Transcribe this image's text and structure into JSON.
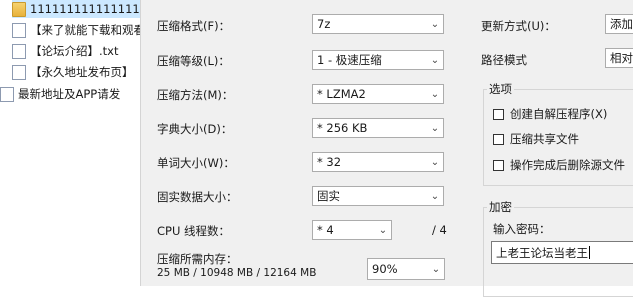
{
  "files": [
    {
      "name": "1111111111111111",
      "type": "folder",
      "selected": true
    },
    {
      "name": "【来了就能下载和观看",
      "type": "doc"
    },
    {
      "name": "【论坛介绍】.txt",
      "type": "doc"
    },
    {
      "name": "【永久地址发布页】",
      "type": "doc"
    },
    {
      "name": "最新地址及APP请发",
      "type": "doc"
    }
  ],
  "form": {
    "format_label": "压缩格式(F)：",
    "format_value": "7z",
    "level_label": "压缩等级(L)：",
    "level_value": "1 - 极速压缩",
    "method_label": "压缩方法(M)：",
    "method_value": "* LZMA2",
    "dict_label": "字典大小(D)：",
    "dict_value": "* 256 KB",
    "word_label": "单词大小(W)：",
    "word_value": "* 32",
    "solid_label": "固实数据大小：",
    "solid_value": "固实",
    "cpu_label": "CPU 线程数：",
    "cpu_value": "* 4",
    "cpu_total": "/ 4",
    "memory_label": "压缩所需内存：",
    "memory_detail": "25 MB / 10948 MB / 12164 MB",
    "memory_percent": "90%",
    "update_label": "更新方式(U)：",
    "update_value": "添加",
    "path_label": "路径模式",
    "path_value": "相对",
    "options_title": "选项",
    "options": [
      {
        "label": "创建自解压程序(X)",
        "checked": false
      },
      {
        "label": "压缩共享文件",
        "checked": false
      },
      {
        "label": "操作完成后删除源文件",
        "checked": false
      }
    ],
    "encrypt_title": "加密",
    "password_label": "输入密码：",
    "password_value": "上老王论坛当老王"
  }
}
